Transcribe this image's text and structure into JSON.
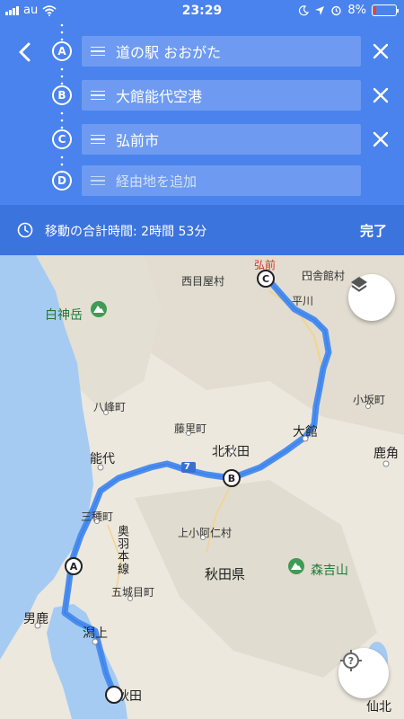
{
  "status_bar": {
    "carrier": "au",
    "time": "23:29",
    "battery": "8%"
  },
  "header": {
    "stops": [
      {
        "letter": "A",
        "text": "道の駅 おおがた",
        "placeholder": false
      },
      {
        "letter": "B",
        "text": "大館能代空港",
        "placeholder": false
      },
      {
        "letter": "C",
        "text": "弘前市",
        "placeholder": false
      },
      {
        "letter": "D",
        "text": "経由地を追加",
        "placeholder": true
      }
    ]
  },
  "summary": {
    "total_time": "移動の合計時間: 2時間 53分",
    "done_label": "完了"
  },
  "map": {
    "labels": {
      "hirosaki": "弘前",
      "inakadate": "田舎館村",
      "nishimeya": "西目屋村",
      "hiraka": "平川",
      "shirakami": "白神岳",
      "happo": "八峰町",
      "fujisato": "藤里町",
      "kosaka": "小坂町",
      "odate": "大館",
      "kazuno": "鹿角",
      "kitaakita": "北秋田",
      "noshiro": "能代",
      "mitane": "三種町",
      "ou": "奥羽本線",
      "kamikoani": "上小阿仁村",
      "akita_pref": "秋田県",
      "moriyoshi": "森吉山",
      "gojome": "五城目町",
      "oga": "男鹿",
      "yugami": "潟上",
      "akita_city": "秋田",
      "senboku": "仙北",
      "route_no": "7"
    },
    "markers": [
      "A",
      "B",
      "C"
    ]
  },
  "colors": {
    "header": "#4a83ee",
    "summary_bar": "#3c74dd",
    "route": "#4b8ef0",
    "sea": "#a6cbf2"
  }
}
